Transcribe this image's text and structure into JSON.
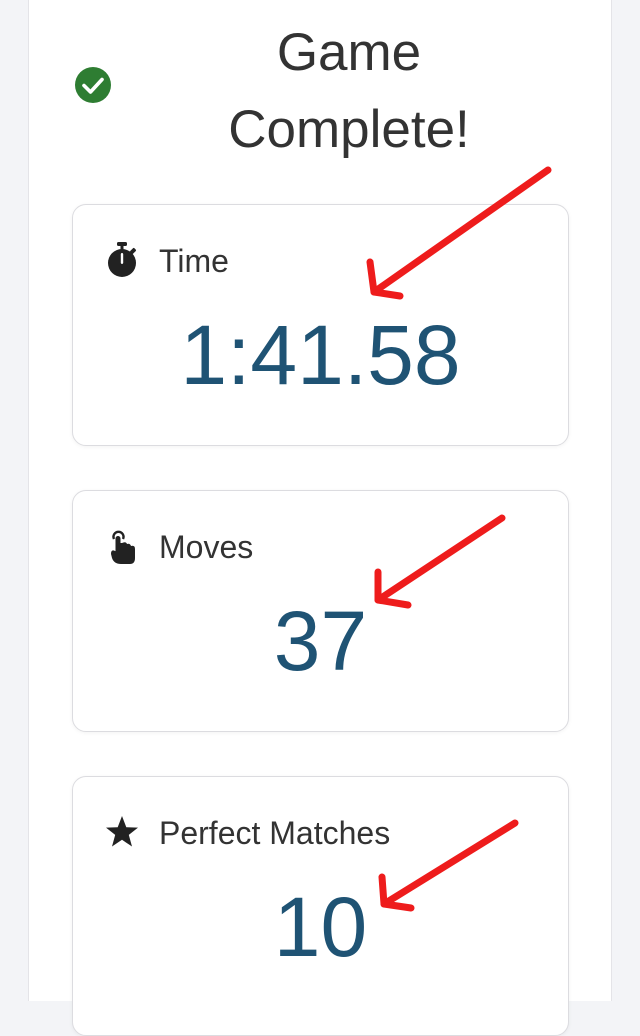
{
  "header": {
    "title_line1": "Game",
    "title_line2": "Complete!",
    "check_color": "#2e7d32"
  },
  "stats": {
    "time": {
      "label": "Time",
      "value": "1:41.58",
      "icon": "stopwatch-icon"
    },
    "moves": {
      "label": "Moves",
      "value": "37",
      "icon": "tap-hand-icon"
    },
    "perfect": {
      "label": "Perfect Matches",
      "value": "10",
      "icon": "star-icon"
    }
  },
  "colors": {
    "value": "#1f5374",
    "annotation_arrow": "#ee1c1c"
  }
}
